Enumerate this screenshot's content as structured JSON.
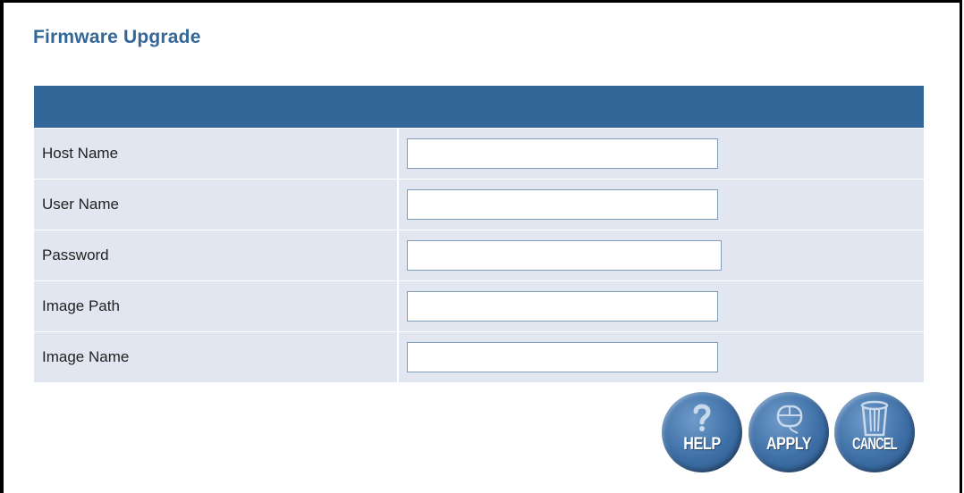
{
  "page": {
    "title": "Firmware Upgrade"
  },
  "form": {
    "rows": [
      {
        "label": "Host Name",
        "value": ""
      },
      {
        "label": "User Name",
        "value": ""
      },
      {
        "label": "Password",
        "value": ""
      },
      {
        "label": "Image Path",
        "value": ""
      },
      {
        "label": "Image Name",
        "value": ""
      }
    ]
  },
  "buttons": {
    "help": {
      "label": "HELP",
      "icon": "question-mark-icon"
    },
    "apply": {
      "label": "APPLY",
      "icon": "mouse-icon"
    },
    "cancel": {
      "label": "CANCEL",
      "icon": "trash-can-icon"
    }
  },
  "colors": {
    "accent": "#336699",
    "row_background": "#e1e6f0",
    "button_blue": "#3d6fa6"
  }
}
